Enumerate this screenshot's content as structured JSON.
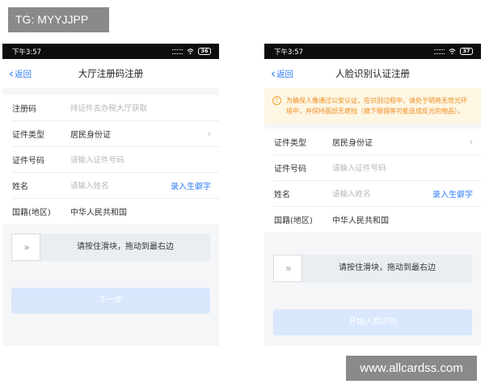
{
  "watermarks": {
    "top_left": "TG: MYYJJPP",
    "bottom_right": "www.allcardss.com"
  },
  "left_screen": {
    "status": {
      "time": "下午3:57",
      "battery": "36"
    },
    "nav": {
      "back_label": "返回",
      "title": "大厅注册码注册"
    },
    "fields": {
      "reg_code": {
        "label": "注册码",
        "placeholder": "持证件去办税大厅获取"
      },
      "id_type": {
        "label": "证件类型",
        "value": "居民身份证"
      },
      "id_number": {
        "label": "证件号码",
        "placeholder": "请输入证件号码"
      },
      "name": {
        "label": "姓名",
        "placeholder": "请输入姓名",
        "action": "录入生僻字"
      },
      "nationality": {
        "label": "国籍(地区)",
        "value": "中华人民共和国"
      }
    },
    "slider": {
      "handle": "»",
      "hint": "请按住滑块，拖动到最右边"
    },
    "submit_label": "下一步"
  },
  "right_screen": {
    "status": {
      "time": "下午3:57",
      "battery": "37"
    },
    "nav": {
      "back_label": "返回",
      "title": "人脸识别认证注册"
    },
    "notice": {
      "icon": "!",
      "text": "为确保人像通过公安认证，在识别过程中，请处于明亮无背光环境中，并保持面部无遮挡（摘下眼镜等可能造成反光的物品）。"
    },
    "fields": {
      "id_type": {
        "label": "证件类型",
        "value": "居民身份证"
      },
      "id_number": {
        "label": "证件号码",
        "placeholder": "请输入证件号码"
      },
      "name": {
        "label": "姓名",
        "placeholder": "请输入姓名",
        "action": "录入生僻字"
      },
      "nationality": {
        "label": "国籍(地区)",
        "value": "中华人民共和国"
      }
    },
    "slider": {
      "handle": "»",
      "hint": "请按住滑块，拖动到最右边"
    },
    "submit_label": "开始人脸识别"
  },
  "colors": {
    "accent": "#2f7df6",
    "notice_text": "#f08c1e",
    "button_disabled": "#d9e8fd"
  },
  "icons": {
    "back": "chevron-left-icon",
    "row_arrow": "chevron-right-icon",
    "slider_handle": "double-chevron-right-icon",
    "notice": "warning-icon"
  }
}
